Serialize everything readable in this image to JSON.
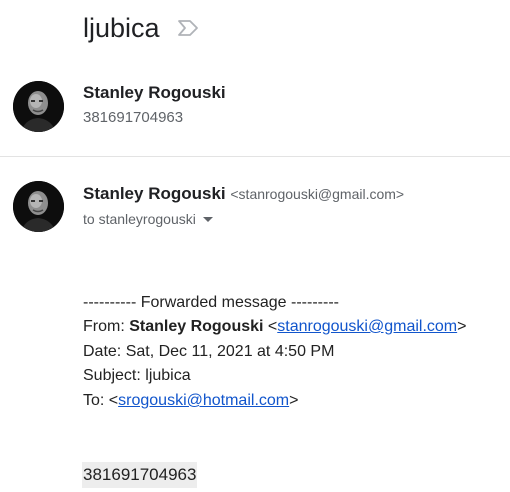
{
  "thread": {
    "subject": "ljubica",
    "label_icon": "label-forward-icon"
  },
  "collapsed_message": {
    "sender_name": "Stanley Rogouski",
    "snippet": "381691704963",
    "avatar": "avatar-photo"
  },
  "expanded_message": {
    "sender_name": "Stanley Rogouski",
    "sender_email": "<stanrogouski@gmail.com>",
    "to_label": "to stanleyrogouski",
    "to_caret_icon": "caret-down-icon",
    "avatar": "avatar-photo"
  },
  "forwarded": {
    "header": "---------- Forwarded message ---------",
    "from_label": "From: ",
    "from_name": "Stanley Rogouski",
    "from_open": " <",
    "from_email": "stanrogouski@gmail.com",
    "from_close": ">",
    "date_line": "Date: Sat, Dec 11, 2021 at 4:50 PM",
    "subject_line": "Subject: ljubica",
    "to_label": "To: <",
    "to_email": "srogouski@hotmail.com",
    "to_close": ">",
    "body_number": "381691704963"
  },
  "colors": {
    "link": "#1155cc",
    "text": "#202124",
    "muted": "#5f6368",
    "divider": "#e3e3e3",
    "highlight_bg": "#ededed"
  }
}
